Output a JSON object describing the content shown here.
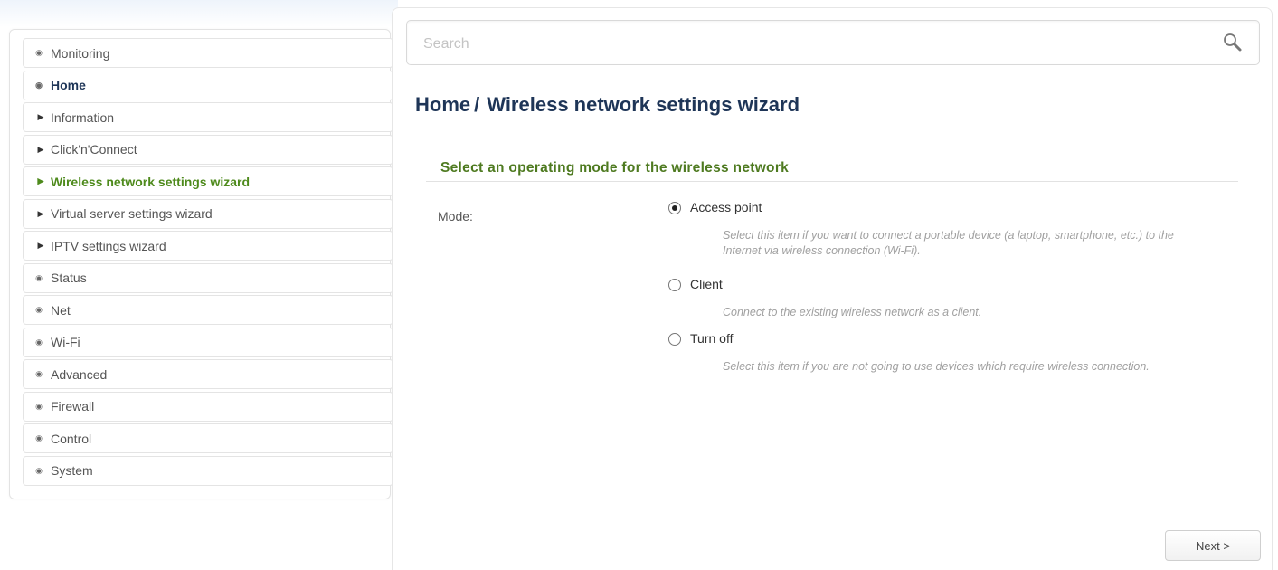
{
  "sidebar": {
    "items": [
      {
        "label": "Monitoring",
        "level": "top",
        "icon": "circle-arrow-right-icon"
      },
      {
        "label": "Home",
        "level": "top",
        "icon": "circle-arrow-down-icon",
        "expanded": true
      },
      {
        "label": "Information",
        "level": "sub",
        "icon": "triangle-right-icon"
      },
      {
        "label": "Click'n'Connect",
        "level": "sub",
        "icon": "triangle-right-icon"
      },
      {
        "label": "Wireless network settings wizard",
        "level": "sub",
        "icon": "triangle-right-icon",
        "active": true
      },
      {
        "label": "Virtual server settings wizard",
        "level": "sub",
        "icon": "triangle-right-icon"
      },
      {
        "label": "IPTV settings wizard",
        "level": "sub",
        "icon": "triangle-right-icon"
      },
      {
        "label": "Status",
        "level": "top",
        "icon": "circle-arrow-right-icon"
      },
      {
        "label": "Net",
        "level": "top",
        "icon": "circle-arrow-right-icon"
      },
      {
        "label": "Wi-Fi",
        "level": "top",
        "icon": "circle-arrow-right-icon"
      },
      {
        "label": "Advanced",
        "level": "top",
        "icon": "circle-arrow-right-icon"
      },
      {
        "label": "Firewall",
        "level": "top",
        "icon": "circle-arrow-right-icon"
      },
      {
        "label": "Control",
        "level": "top",
        "icon": "circle-arrow-right-icon"
      },
      {
        "label": "System",
        "level": "top",
        "icon": "circle-arrow-right-icon"
      }
    ]
  },
  "search": {
    "placeholder": "Search",
    "value": "",
    "icon": "search-icon"
  },
  "page": {
    "breadcrumb_root": "Home",
    "breadcrumb_sep": "/",
    "title": "Wireless network settings wizard"
  },
  "section": {
    "title": "Select an operating mode for the wireless network",
    "mode_label": "Mode:",
    "options": [
      {
        "label": "Access point",
        "checked": true,
        "description": "Select this item if you want to connect a portable device (a laptop, smartphone, etc.) to the Internet via wireless connection (Wi-Fi)."
      },
      {
        "label": "Client",
        "checked": false,
        "description": "Connect to the existing wireless network as a client."
      },
      {
        "label": "Turn off",
        "checked": false,
        "description": "Select this item if you are not going to use devices which require wireless connection."
      }
    ]
  },
  "actions": {
    "next_label": "Next >"
  },
  "colors": {
    "title": "#1e3557",
    "section_title": "#4e7a20",
    "active_menu": "#4e8a1c",
    "description": "#a0a0a0"
  }
}
